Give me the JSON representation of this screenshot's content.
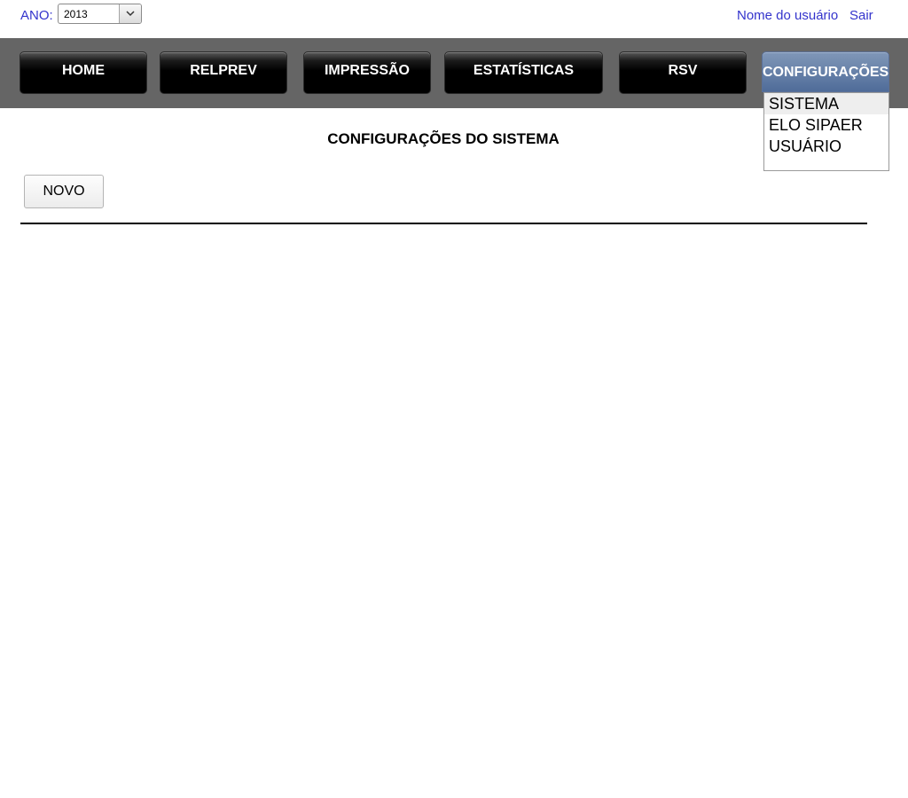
{
  "header": {
    "year_label": "ANO:",
    "year_selected": "2013",
    "user_name": "Nome do usuário",
    "logout": "Sair"
  },
  "nav": {
    "home": "HOME",
    "relprev": "RELPREV",
    "impressao": "IMPRESSÃO",
    "estatisticas": "ESTATÍSTICAS",
    "rsv": "RSV",
    "configuracoes": "CONFIGURAÇÕES"
  },
  "dropdown": {
    "items": [
      "SISTEMA",
      "ELO SIPAER",
      "USUÁRIO"
    ]
  },
  "main": {
    "title": "CONFIGURAÇÕES DO SISTEMA",
    "new_button": "NOVO"
  },
  "colors": {
    "link": "#3333cc",
    "navbar_bg": "#656565",
    "nav_active": "#4f6c99"
  }
}
